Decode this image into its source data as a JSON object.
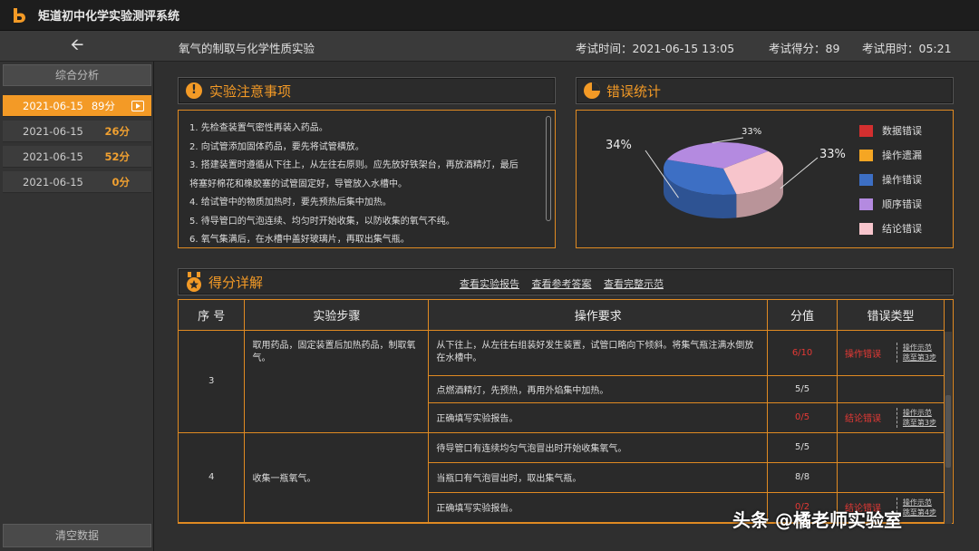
{
  "app": {
    "title": "矩道初中化学实验测评系统"
  },
  "header": {
    "experiment": "氧气的制取与化学性质实验",
    "exam_time_label": "考试时间：2021-06-15 13:05",
    "score_label": "考试得分：89",
    "duration_label": "考试用时：05:21"
  },
  "sidebar": {
    "title": "综合分析",
    "items": [
      {
        "date": "2021-06-15",
        "score": "89分",
        "active": true
      },
      {
        "date": "2021-06-15",
        "score": "26分"
      },
      {
        "date": "2021-06-15",
        "score": "52分"
      },
      {
        "date": "2021-06-15",
        "score": "0分"
      }
    ],
    "clear_label": "清空数据"
  },
  "notes": {
    "title": "实验注意事项",
    "lines": [
      "1. 先检查装置气密性再装入药品。",
      "2. 向试管添加固体药品，要先将试管横放。",
      "3. 搭建装置时遵循从下往上，从左往右原则。应先放好铁架台，再放酒精灯，最后",
      "将塞好棉花和橡胶塞的试管固定好，导管放入水槽中。",
      "4. 给试管中的物质加热时，要先预热后集中加热。",
      "5. 待导管口的气泡连续、均匀时开始收集，以防收集的氧气不纯。",
      "6. 氧气集满后，在水槽中盖好玻璃片，再取出集气瓶。"
    ]
  },
  "errors": {
    "title": "错误统计",
    "legend": [
      {
        "label": "数据错误",
        "color": "#d32f2f"
      },
      {
        "label": "操作遗漏",
        "color": "#f5a623"
      },
      {
        "label": "操作错误",
        "color": "#3d6fc4"
      },
      {
        "label": "顺序错误",
        "color": "#b48ae0"
      },
      {
        "label": "结论错误",
        "color": "#f7c5cc"
      }
    ]
  },
  "chart_data": {
    "type": "pie",
    "slices": [
      {
        "label": "操作错误",
        "value": 34,
        "text": "34%",
        "color": "#3d6fc4"
      },
      {
        "label": "顺序错误",
        "value": 33,
        "text": "33%",
        "color": "#b48ae0"
      },
      {
        "label": "结论错误",
        "value": 33,
        "text": "33%",
        "color": "#f7c5cc"
      }
    ]
  },
  "score": {
    "title": "得分详解",
    "links": [
      "查看实验报告",
      "查看参考答案",
      "查看完整示范"
    ],
    "headers": [
      "序 号",
      "实验步骤",
      "操作要求",
      "分值",
      "错误类型"
    ],
    "groups": [
      {
        "no": "3",
        "step": "取用药品，固定装置后加热药品，制取氧气。",
        "rows": [
          {
            "req": "从下往上，从左往右组装好发生装置，试管口略向下倾斜。将集气瓶注满水倒放在水槽中。",
            "score": "6/10",
            "bad": true,
            "err": "操作错误",
            "op1": "操作示范",
            "op2": "跳至第3步"
          },
          {
            "req": "点燃酒精灯，先预热，再用外焰集中加热。",
            "score": "5/5",
            "bad": false,
            "err": "",
            "op1": "",
            "op2": ""
          },
          {
            "req": "正确填写实验报告。",
            "score": "0/5",
            "bad": true,
            "err": "结论错误",
            "op1": "操作示范",
            "op2": "跳至第3步"
          }
        ]
      },
      {
        "no": "4",
        "step": "收集一瓶氧气。",
        "rows": [
          {
            "req": "待导管口有连续均匀气泡冒出时开始收集氧气。",
            "score": "5/5",
            "bad": false,
            "err": "",
            "op1": "",
            "op2": ""
          },
          {
            "req": "当瓶口有气泡冒出时，取出集气瓶。",
            "score": "8/8",
            "bad": false,
            "err": "",
            "op1": "",
            "op2": ""
          },
          {
            "req": "正确填写实验报告。",
            "score": "0/2",
            "bad": true,
            "err": "结论错误",
            "op1": "操作示范",
            "op2": "跳至第4步"
          }
        ]
      }
    ]
  },
  "watermark": "头条 @橘老师实验室"
}
